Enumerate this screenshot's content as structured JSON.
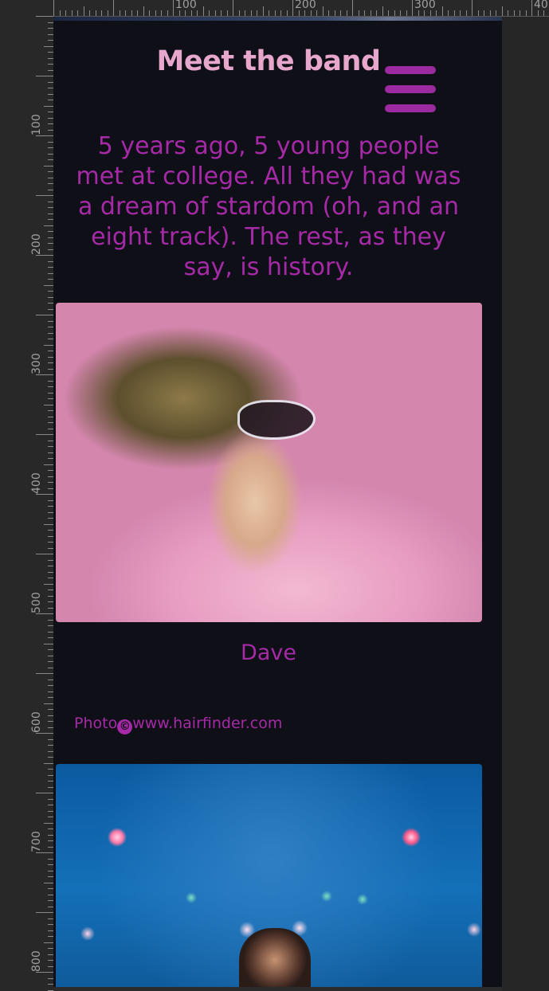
{
  "ruler": {
    "horizontal_labels": [
      "100",
      "200",
      "300",
      "40"
    ],
    "vertical_labels": [
      "100",
      "200",
      "300",
      "400",
      "500",
      "600",
      "700",
      "800"
    ]
  },
  "header": {
    "title": "Meet the band",
    "menu_icon": "hamburger-menu-icon"
  },
  "intro": {
    "text": "5 years ago, 5 young people met at college. All they had was a dream of stardom (oh, and an eight track). The rest, as they say, is history."
  },
  "members": [
    {
      "name": "Dave",
      "credit_prefix": "Photo",
      "credit_symbol": "©",
      "credit_source": "www.hairfinder.com"
    }
  ],
  "colors": {
    "background": "#0f0f17",
    "title": "#e7a6cc",
    "accent": "#a62aa7",
    "menu": "#9b2aa0"
  }
}
